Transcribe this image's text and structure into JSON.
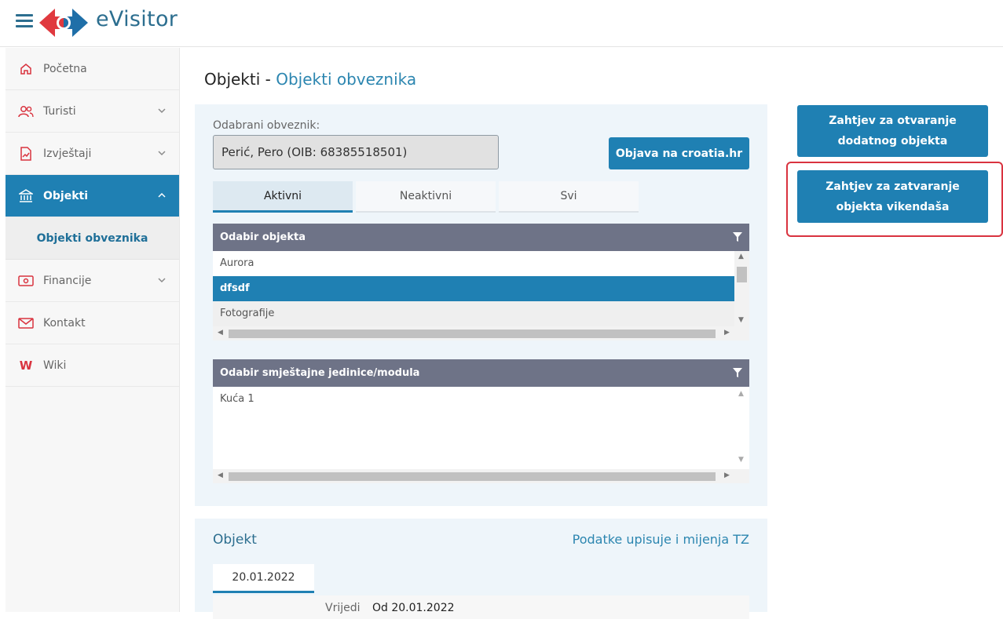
{
  "header": {
    "brand": "eVisitor"
  },
  "sidebar": {
    "items": [
      {
        "label": "Početna"
      },
      {
        "label": "Turisti"
      },
      {
        "label": "Izvještaji"
      },
      {
        "label": "Objekti"
      },
      {
        "label": "Financije"
      },
      {
        "label": "Kontakt"
      },
      {
        "label": "Wiki"
      }
    ],
    "sub_item": "Objekti obveznika",
    "wiki_icon_text": "W"
  },
  "page": {
    "title": "Objekti - ",
    "subtitle": "Objekti obveznika"
  },
  "form": {
    "obveznik_label": "Odabrani obveznik:",
    "obveznik_value": "Perić, Pero (OIB: 68385518501)",
    "objava_button": "Objava na croatia.hr"
  },
  "tabs": [
    {
      "label": "Aktivni"
    },
    {
      "label": "Neaktivni"
    },
    {
      "label": "Svi"
    }
  ],
  "grid_objekti": {
    "header": "Odabir objekta",
    "rows": [
      "Aurora",
      "dfsdf",
      "Fotografije"
    ]
  },
  "grid_jedinice": {
    "header": "Odabir smještajne jedinice/modula",
    "rows": [
      "Kuća 1"
    ]
  },
  "right_buttons": {
    "otvaranje": "Zahtjev za otvaranje dodatnog objekta",
    "zatvaranje": "Zahtjev za zatvaranje objekta vikendaša"
  },
  "objekt": {
    "title": "Objekt",
    "link": "Podatke upisuje i mijenja TZ",
    "date_tab": "20.01.2022",
    "detail_label": "Vrijedi",
    "detail_value": "Od 20.01.2022"
  },
  "colors": {
    "accent": "#1f80b3",
    "brand_red": "#d9333f",
    "grid_header": "#6e7387",
    "highlight": "#d9333f"
  }
}
